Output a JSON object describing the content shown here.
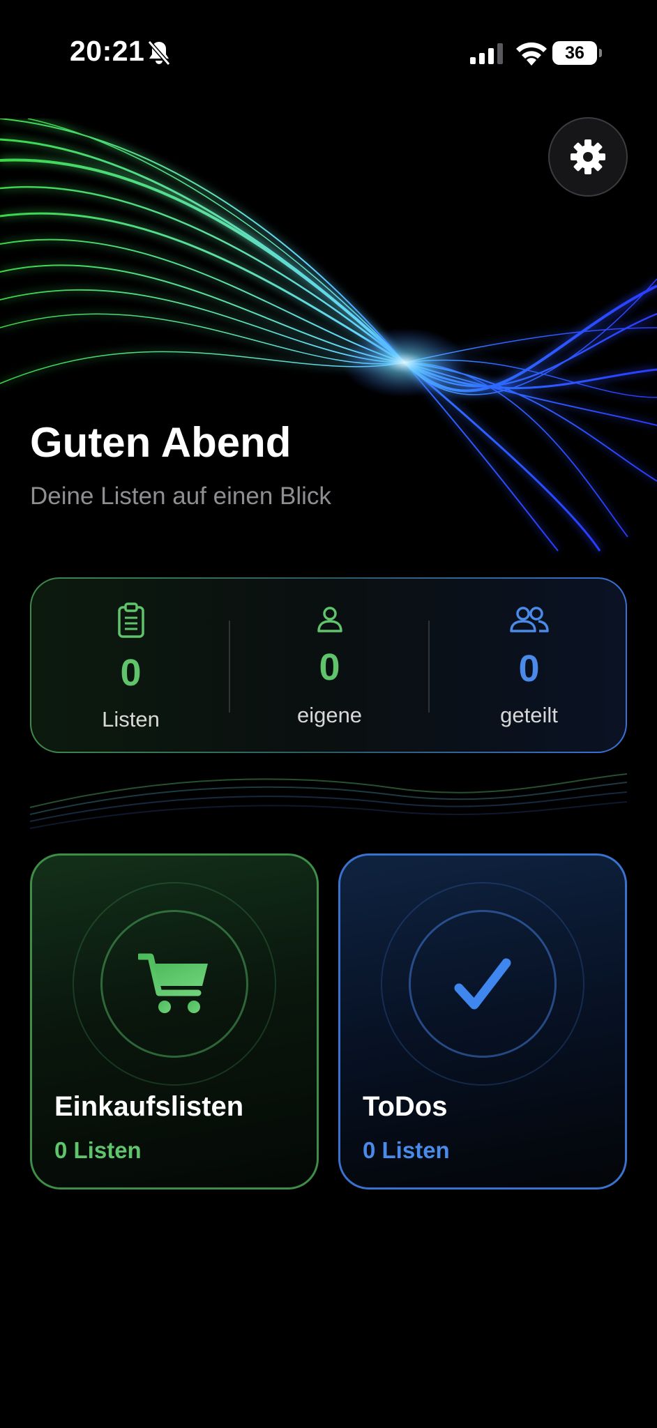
{
  "status_bar": {
    "time": "20:21",
    "battery": "36",
    "icons": [
      "bell-slash-icon",
      "cellular-signal-icon",
      "wifi-icon",
      "battery-icon"
    ]
  },
  "header": {
    "greeting": "Guten Abend",
    "subtitle": "Deine Listen auf einen Blick",
    "settings_icon": "gear-icon"
  },
  "stats": [
    {
      "icon": "clipboard-icon",
      "value": "0",
      "label": "Listen",
      "color": "#5fc46c"
    },
    {
      "icon": "person-icon",
      "value": "0",
      "label": "eigene",
      "color": "#5fc46c"
    },
    {
      "icon": "people-icon",
      "value": "0",
      "label": "geteilt",
      "color": "#4a8ae8"
    }
  ],
  "categories": [
    {
      "icon": "cart-icon",
      "title": "Einkaufslisten",
      "count": "0 Listen",
      "accent": "#5fc46c"
    },
    {
      "icon": "checkmark-icon",
      "title": "ToDos",
      "count": "0 Listen",
      "accent": "#4a8ae8"
    }
  ]
}
